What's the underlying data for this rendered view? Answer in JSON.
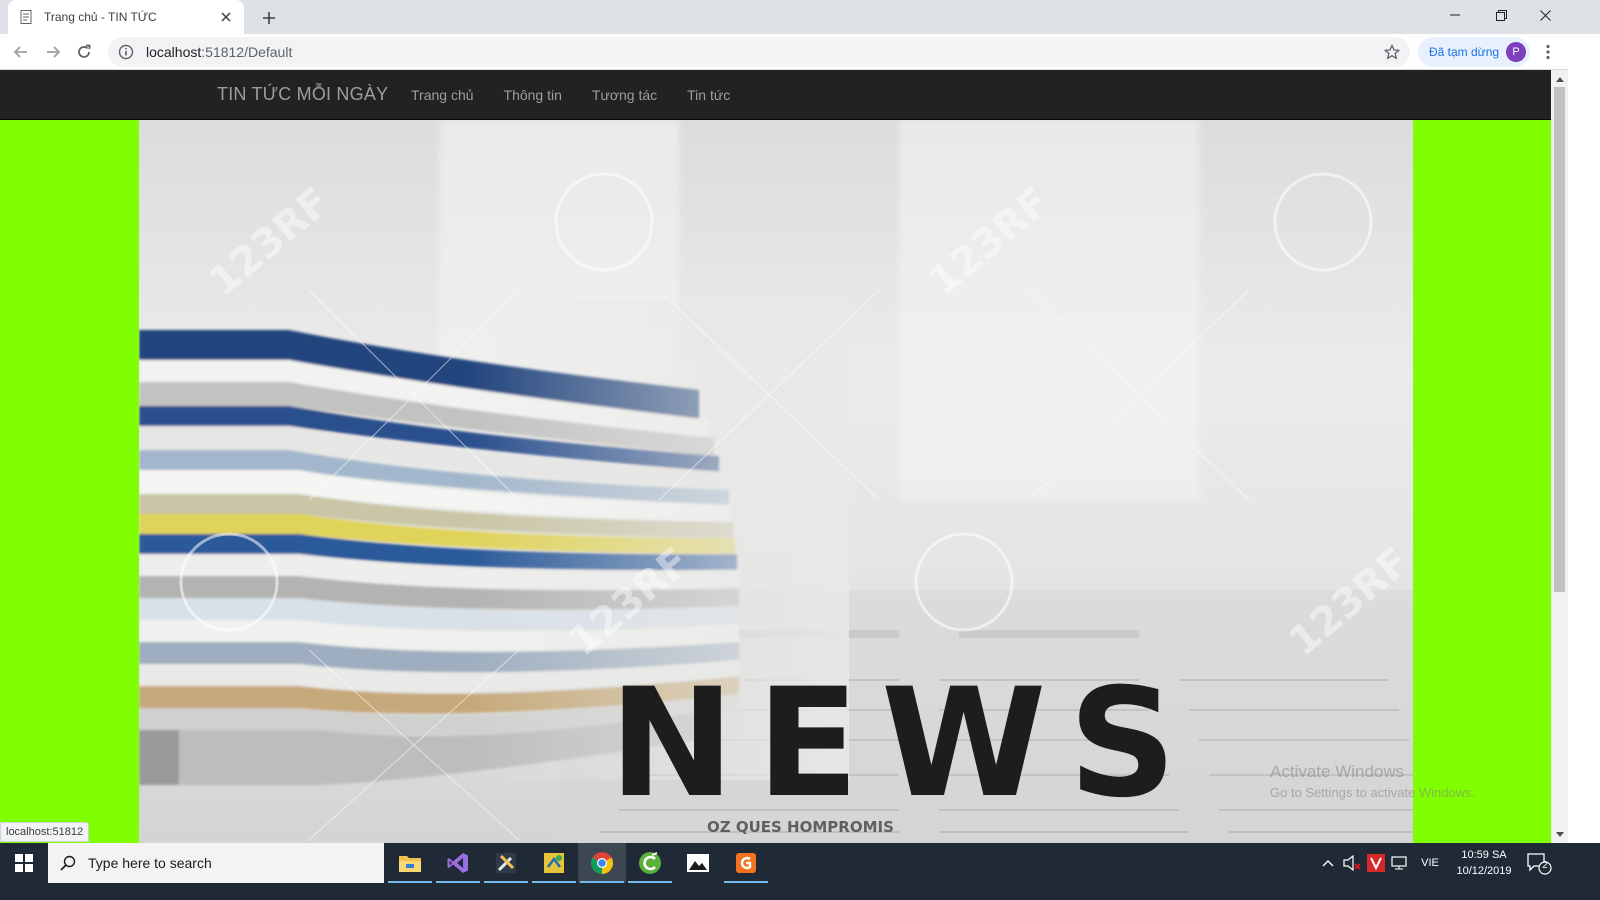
{
  "browser": {
    "tab_title": "Trang chủ - TIN TỨC",
    "url_host": "localhost",
    "url_path": ":51812/Default",
    "profile_label": "Đã tạm dừng",
    "profile_initial": "P",
    "status_link": "localhost:51812"
  },
  "site": {
    "brand": "TIN TỨC MỖI NGÀY",
    "nav": [
      {
        "label": "Trang chủ"
      },
      {
        "label": "Thông tin"
      },
      {
        "label": "Tương tác"
      },
      {
        "label": "Tin tức"
      }
    ],
    "background_color": "#7fff00",
    "navbar_color": "#222222",
    "hero": {
      "headline": "NEWS",
      "newsprint_text": "OZ QUES  HOMPROMIS",
      "watermark": "123RF"
    }
  },
  "windows_overlay": {
    "title": "Activate Windows",
    "subtitle": "Go to Settings to activate Windows."
  },
  "taskbar": {
    "search_placeholder": "Type here to search",
    "language": "VIE",
    "time": "10:59 SA",
    "date": "10/12/2019",
    "notification_count": "2",
    "apps": [
      {
        "icon": "file-explorer-icon"
      },
      {
        "icon": "visual-studio-icon"
      },
      {
        "icon": "tools-icon"
      },
      {
        "icon": "sync-icon"
      },
      {
        "icon": "chrome-icon"
      },
      {
        "icon": "coccoc-icon"
      },
      {
        "icon": "photos-icon"
      },
      {
        "icon": "foxit-pdf-icon"
      }
    ]
  }
}
